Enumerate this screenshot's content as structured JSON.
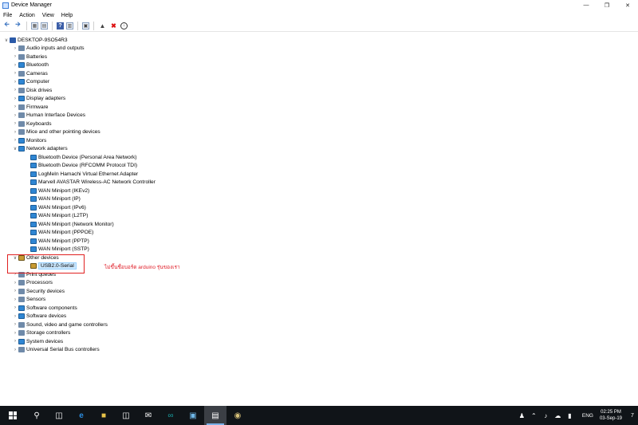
{
  "window": {
    "title": "Device Manager"
  },
  "menu": [
    "File",
    "Action",
    "View",
    "Help"
  ],
  "tree": {
    "root": "DESKTOP-9SO54R3",
    "categories": [
      "Audio inputs and outputs",
      "Batteries",
      "Bluetooth",
      "Cameras",
      "Computer",
      "Disk drives",
      "Display adapters",
      "Firmware",
      "Human Interface Devices",
      "Keyboards",
      "Mice and other pointing devices",
      "Monitors"
    ],
    "network": {
      "label": "Network adapters",
      "children": [
        "Bluetooth Device (Personal Area Network)",
        "Bluetooth Device (RFCOMM Protocol TDI)",
        "LogMeIn Hamachi Virtual Ethernet Adapter",
        "Marvell AVASTAR Wireless-AC Network Controller",
        "WAN Miniport (IKEv2)",
        "WAN Miniport (IP)",
        "WAN Miniport (IPv6)",
        "WAN Miniport (L2TP)",
        "WAN Miniport (Network Monitor)",
        "WAN Miniport (PPPOE)",
        "WAN Miniport (PPTP)",
        "WAN Miniport (SSTP)"
      ]
    },
    "other": {
      "label": "Other devices",
      "child": "USB2.0-Serial"
    },
    "categories_after": [
      "Print queues",
      "Processors",
      "Security devices",
      "Sensors",
      "Software components",
      "Software devices",
      "Sound, video and game controllers",
      "Storage controllers",
      "System devices",
      "Universal Serial Bus controllers"
    ]
  },
  "annotation": "ไม่ขึ้นชื่อบอร์ด arduino รุ่นของเรา",
  "taskbar": {
    "lang": "ENG",
    "time": "02:25 PM",
    "date": "03-Sep-19",
    "notifications": "7"
  }
}
